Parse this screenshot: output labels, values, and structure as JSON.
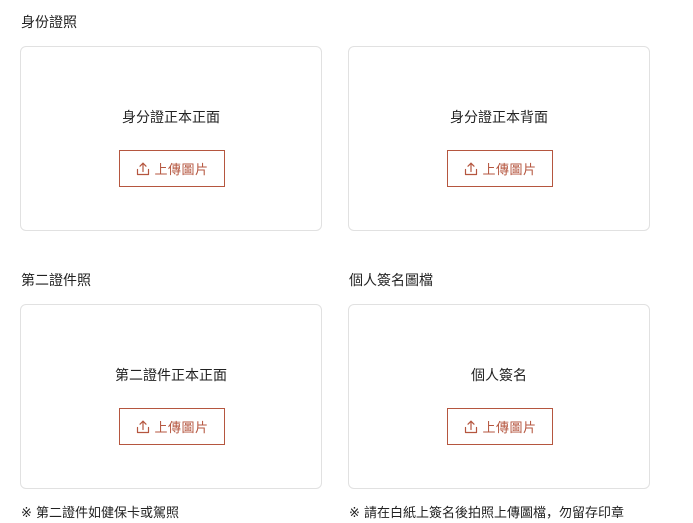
{
  "colors": {
    "accent": "#b5563f",
    "border": "#e1e1e1",
    "text": "#222222"
  },
  "sections": {
    "id_card": {
      "title": "身份證照",
      "front": {
        "label": "身分證正本正面",
        "button": "上傳圖片",
        "icon": "upload-icon"
      },
      "back": {
        "label": "身分證正本背面",
        "button": "上傳圖片",
        "icon": "upload-icon"
      }
    },
    "second_id": {
      "title": "第二證件照",
      "front": {
        "label": "第二證件正本正面",
        "button": "上傳圖片",
        "icon": "upload-icon"
      },
      "note": "※ 第二證件如健保卡或駕照"
    },
    "signature": {
      "title": "個人簽名圖檔",
      "card": {
        "label": "個人簽名",
        "button": "上傳圖片",
        "icon": "upload-icon"
      },
      "note": "※ 請在白紙上簽名後拍照上傳圖檔，勿留存印章"
    }
  }
}
